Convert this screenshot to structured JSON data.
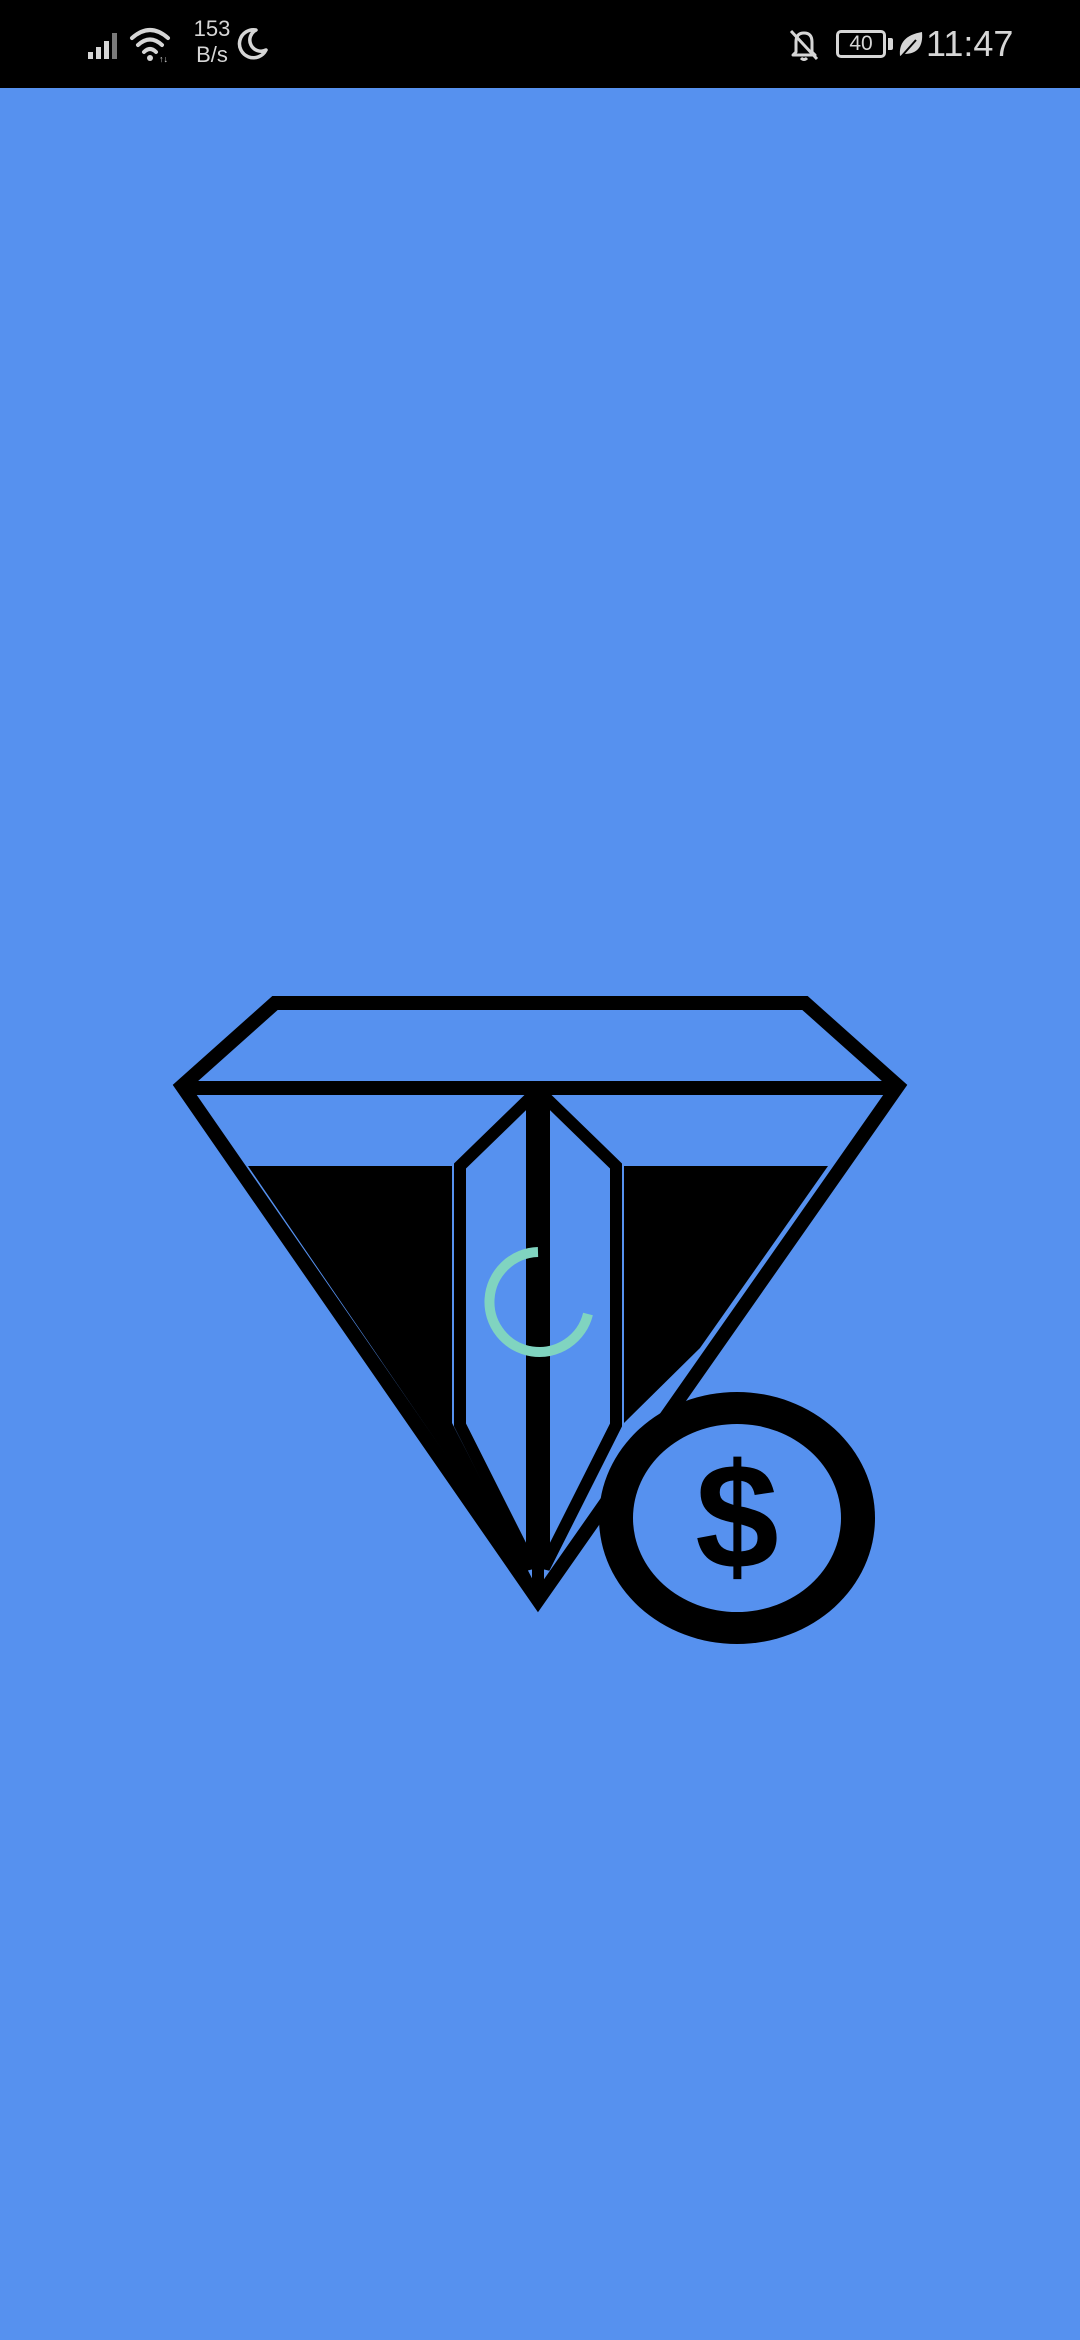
{
  "status_bar": {
    "net_speed_value": "153",
    "net_speed_unit": "B/s",
    "battery_level": "40",
    "time": "11:47",
    "icons": [
      "signal-icon",
      "wifi-icon",
      "moon-icon",
      "bell-off-icon",
      "battery-icon",
      "leaf-icon"
    ]
  },
  "splash": {
    "background_color": "#5691ef",
    "logo_icon": "diamond-dollar-logo-icon",
    "loading_icon": "loading-spinner-icon",
    "spinner_color": "#80d4c0"
  }
}
